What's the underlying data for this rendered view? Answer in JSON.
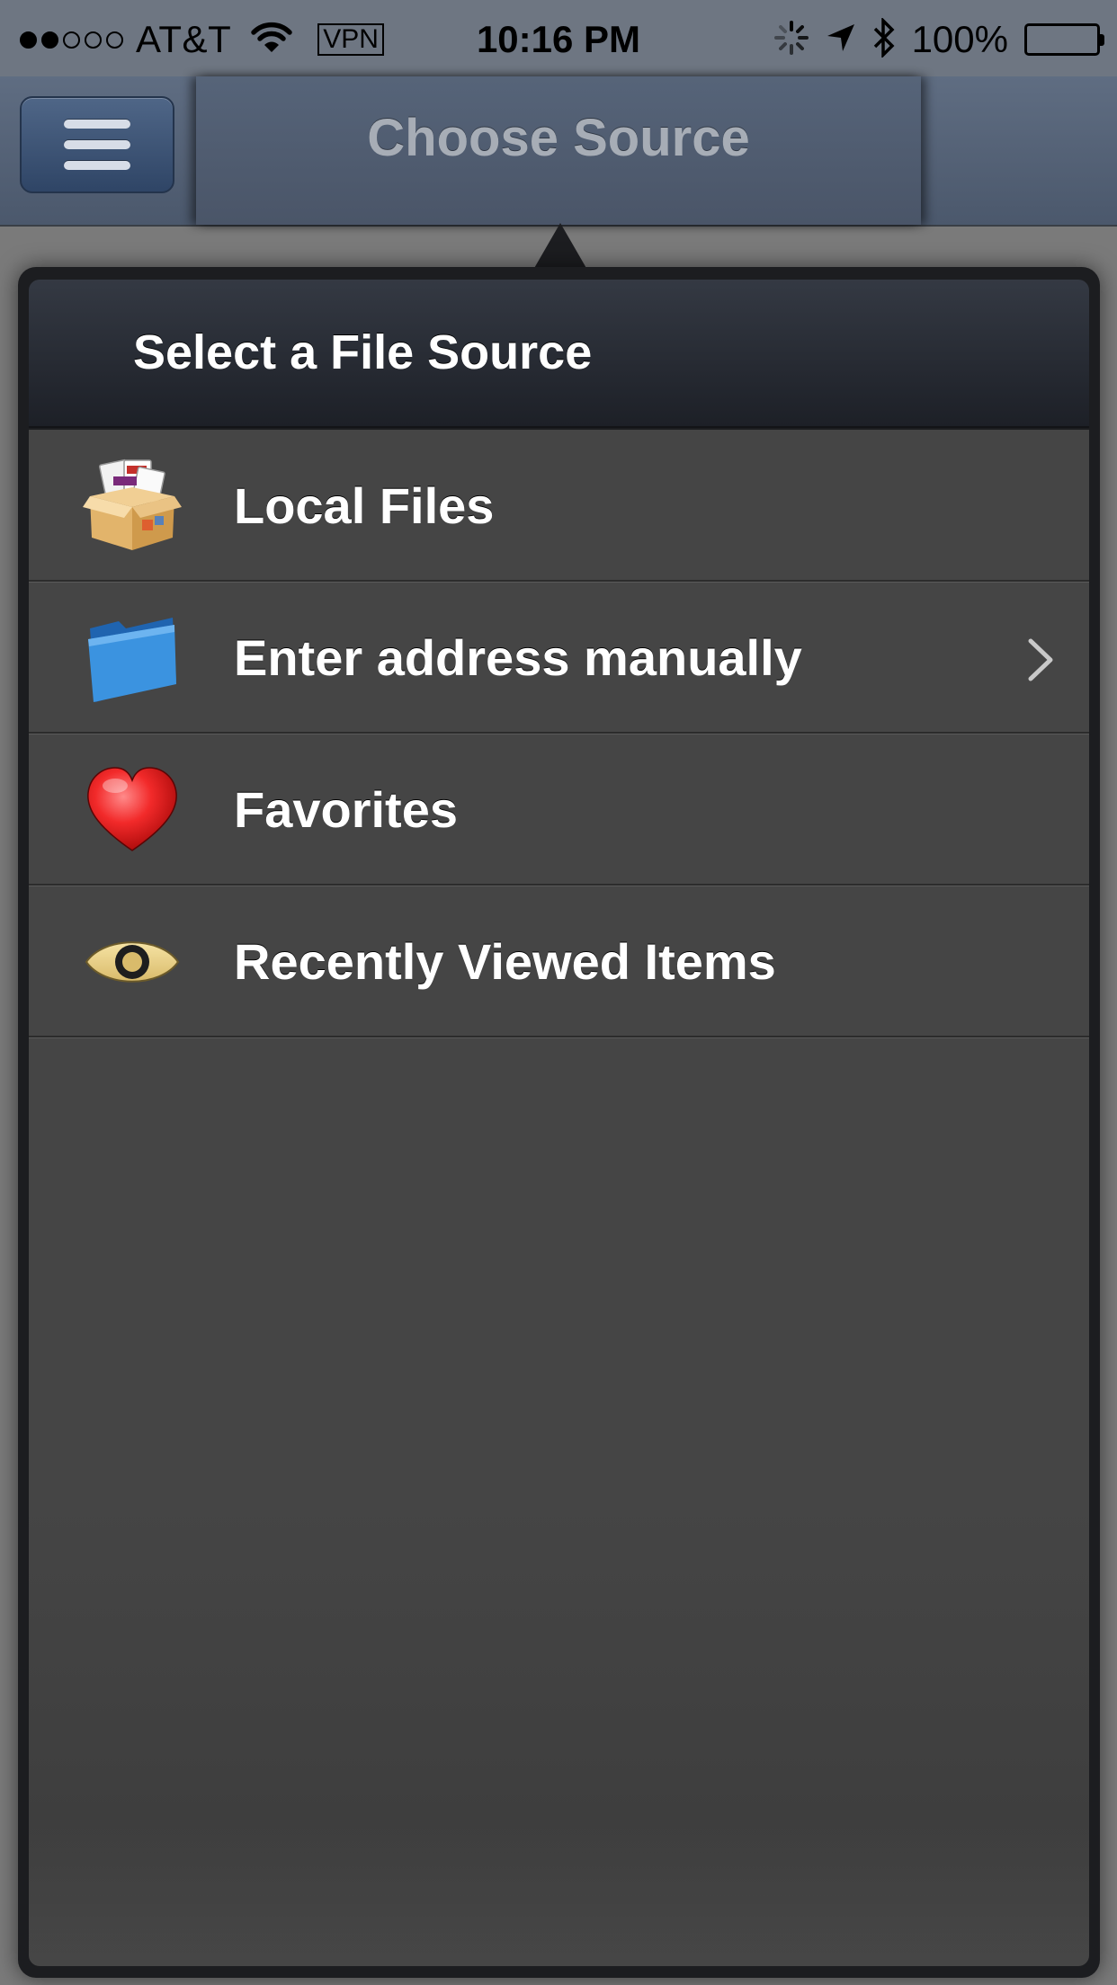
{
  "status_bar": {
    "carrier": "AT&T",
    "signal_bars_filled": 2,
    "signal_bars_total": 5,
    "vpn_label": "VPN",
    "time": "10:16 PM",
    "battery_percent": "100%",
    "icons": [
      "wifi-icon",
      "activity-spinner-icon",
      "location-arrow-icon",
      "bluetooth-icon",
      "battery-icon"
    ]
  },
  "nav_bar": {
    "menu_icon": "hamburger-menu-icon",
    "title": "Choose Source"
  },
  "popover": {
    "title": "Select a File Source",
    "items": [
      {
        "label": "Local Files",
        "icon": "box-of-files-icon",
        "has_disclosure": false
      },
      {
        "label": "Enter address manually",
        "icon": "blue-folder-icon",
        "has_disclosure": true
      },
      {
        "label": "Favorites",
        "icon": "heart-icon",
        "has_disclosure": false
      },
      {
        "label": "Recently Viewed Items",
        "icon": "eye-icon",
        "has_disclosure": false
      }
    ]
  },
  "colors": {
    "nav_bar": "#4b586c",
    "menu_button": "#2f4566",
    "popover_frame": "#1c1d20",
    "list_background": "#454545",
    "text": "#ffffff",
    "folder_blue": "#3b93e0",
    "heart_red": "#e01818"
  }
}
